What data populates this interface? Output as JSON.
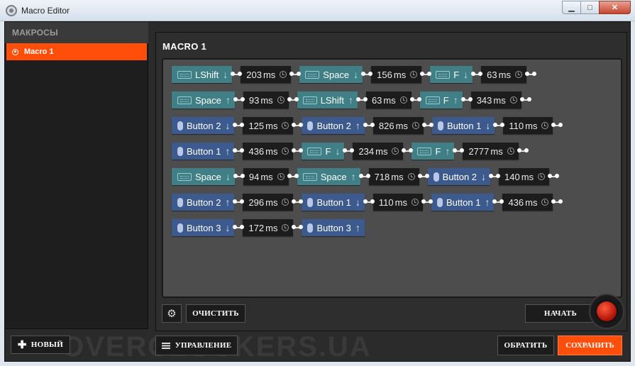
{
  "window": {
    "title": "Macro Editor",
    "minimize": "▁",
    "maximize": "□",
    "close": "✕"
  },
  "sidebar": {
    "header": "МАКРОСЫ",
    "items": [
      {
        "label": "Macro 1",
        "selected": true
      }
    ],
    "new_button": "НОВЫЙ"
  },
  "macro": {
    "title": "MACRO 1",
    "rows": [
      [
        {
          "kind": "key",
          "device": "kb",
          "label": "LShift",
          "dir": "down"
        },
        {
          "kind": "delay",
          "value": "203",
          "unit": "ms"
        },
        {
          "kind": "key",
          "device": "kb",
          "label": "Space",
          "dir": "down"
        },
        {
          "kind": "delay",
          "value": "156",
          "unit": "ms"
        },
        {
          "kind": "key",
          "device": "kb",
          "label": "F",
          "dir": "down"
        },
        {
          "kind": "delay",
          "value": "63",
          "unit": "ms"
        }
      ],
      [
        {
          "kind": "key",
          "device": "kb",
          "label": "Space",
          "dir": "up"
        },
        {
          "kind": "delay",
          "value": "93",
          "unit": "ms"
        },
        {
          "kind": "key",
          "device": "kb",
          "label": "LShift",
          "dir": "up"
        },
        {
          "kind": "delay",
          "value": "63",
          "unit": "ms"
        },
        {
          "kind": "key",
          "device": "kb",
          "label": "F",
          "dir": "up"
        },
        {
          "kind": "delay",
          "value": "343",
          "unit": "ms"
        }
      ],
      [
        {
          "kind": "key",
          "device": "mouse",
          "label": "Button 2",
          "dir": "down"
        },
        {
          "kind": "delay",
          "value": "125",
          "unit": "ms"
        },
        {
          "kind": "key",
          "device": "mouse",
          "label": "Button 2",
          "dir": "up"
        },
        {
          "kind": "delay",
          "value": "826",
          "unit": "ms"
        },
        {
          "kind": "key",
          "device": "mouse",
          "label": "Button 1",
          "dir": "down"
        },
        {
          "kind": "delay",
          "value": "110",
          "unit": "ms"
        }
      ],
      [
        {
          "kind": "key",
          "device": "mouse",
          "label": "Button 1",
          "dir": "up"
        },
        {
          "kind": "delay",
          "value": "436",
          "unit": "ms"
        },
        {
          "kind": "key",
          "device": "kb",
          "label": "F",
          "dir": "down"
        },
        {
          "kind": "delay",
          "value": "234",
          "unit": "ms"
        },
        {
          "kind": "key",
          "device": "kb",
          "label": "F",
          "dir": "up"
        },
        {
          "kind": "delay",
          "value": "2777",
          "unit": "ms"
        }
      ],
      [
        {
          "kind": "key",
          "device": "kb",
          "label": "Space",
          "dir": "down"
        },
        {
          "kind": "delay",
          "value": "94",
          "unit": "ms"
        },
        {
          "kind": "key",
          "device": "kb",
          "label": "Space",
          "dir": "up"
        },
        {
          "kind": "delay",
          "value": "718",
          "unit": "ms"
        },
        {
          "kind": "key",
          "device": "mouse",
          "label": "Button 2",
          "dir": "down"
        },
        {
          "kind": "delay",
          "value": "140",
          "unit": "ms"
        }
      ],
      [
        {
          "kind": "key",
          "device": "mouse",
          "label": "Button 2",
          "dir": "up"
        },
        {
          "kind": "delay",
          "value": "296",
          "unit": "ms"
        },
        {
          "kind": "key",
          "device": "mouse",
          "label": "Button 1",
          "dir": "down"
        },
        {
          "kind": "delay",
          "value": "110",
          "unit": "ms"
        },
        {
          "kind": "key",
          "device": "mouse",
          "label": "Button 1",
          "dir": "up"
        },
        {
          "kind": "delay",
          "value": "436",
          "unit": "ms"
        }
      ],
      [
        {
          "kind": "key",
          "device": "mouse",
          "label": "Button 3",
          "dir": "down"
        },
        {
          "kind": "delay",
          "value": "172",
          "unit": "ms"
        },
        {
          "kind": "key",
          "device": "mouse",
          "label": "Button 3",
          "dir": "up"
        }
      ]
    ],
    "clear_button": "ОЧИСТИТЬ",
    "start_button": "НАЧАТЬ"
  },
  "footer": {
    "manage_button": "УПРАВЛЕНИЕ",
    "revert_button": "ОБРАТИТЬ",
    "save_button": "СОХРАНИТЬ"
  },
  "watermark": "OVERCLOCKERS.UA",
  "colors": {
    "accent": "#ff4d0a",
    "keyboard_key": "#3f7f85",
    "mouse_key": "#3d5a8f",
    "delay": "#1c1c1c"
  }
}
